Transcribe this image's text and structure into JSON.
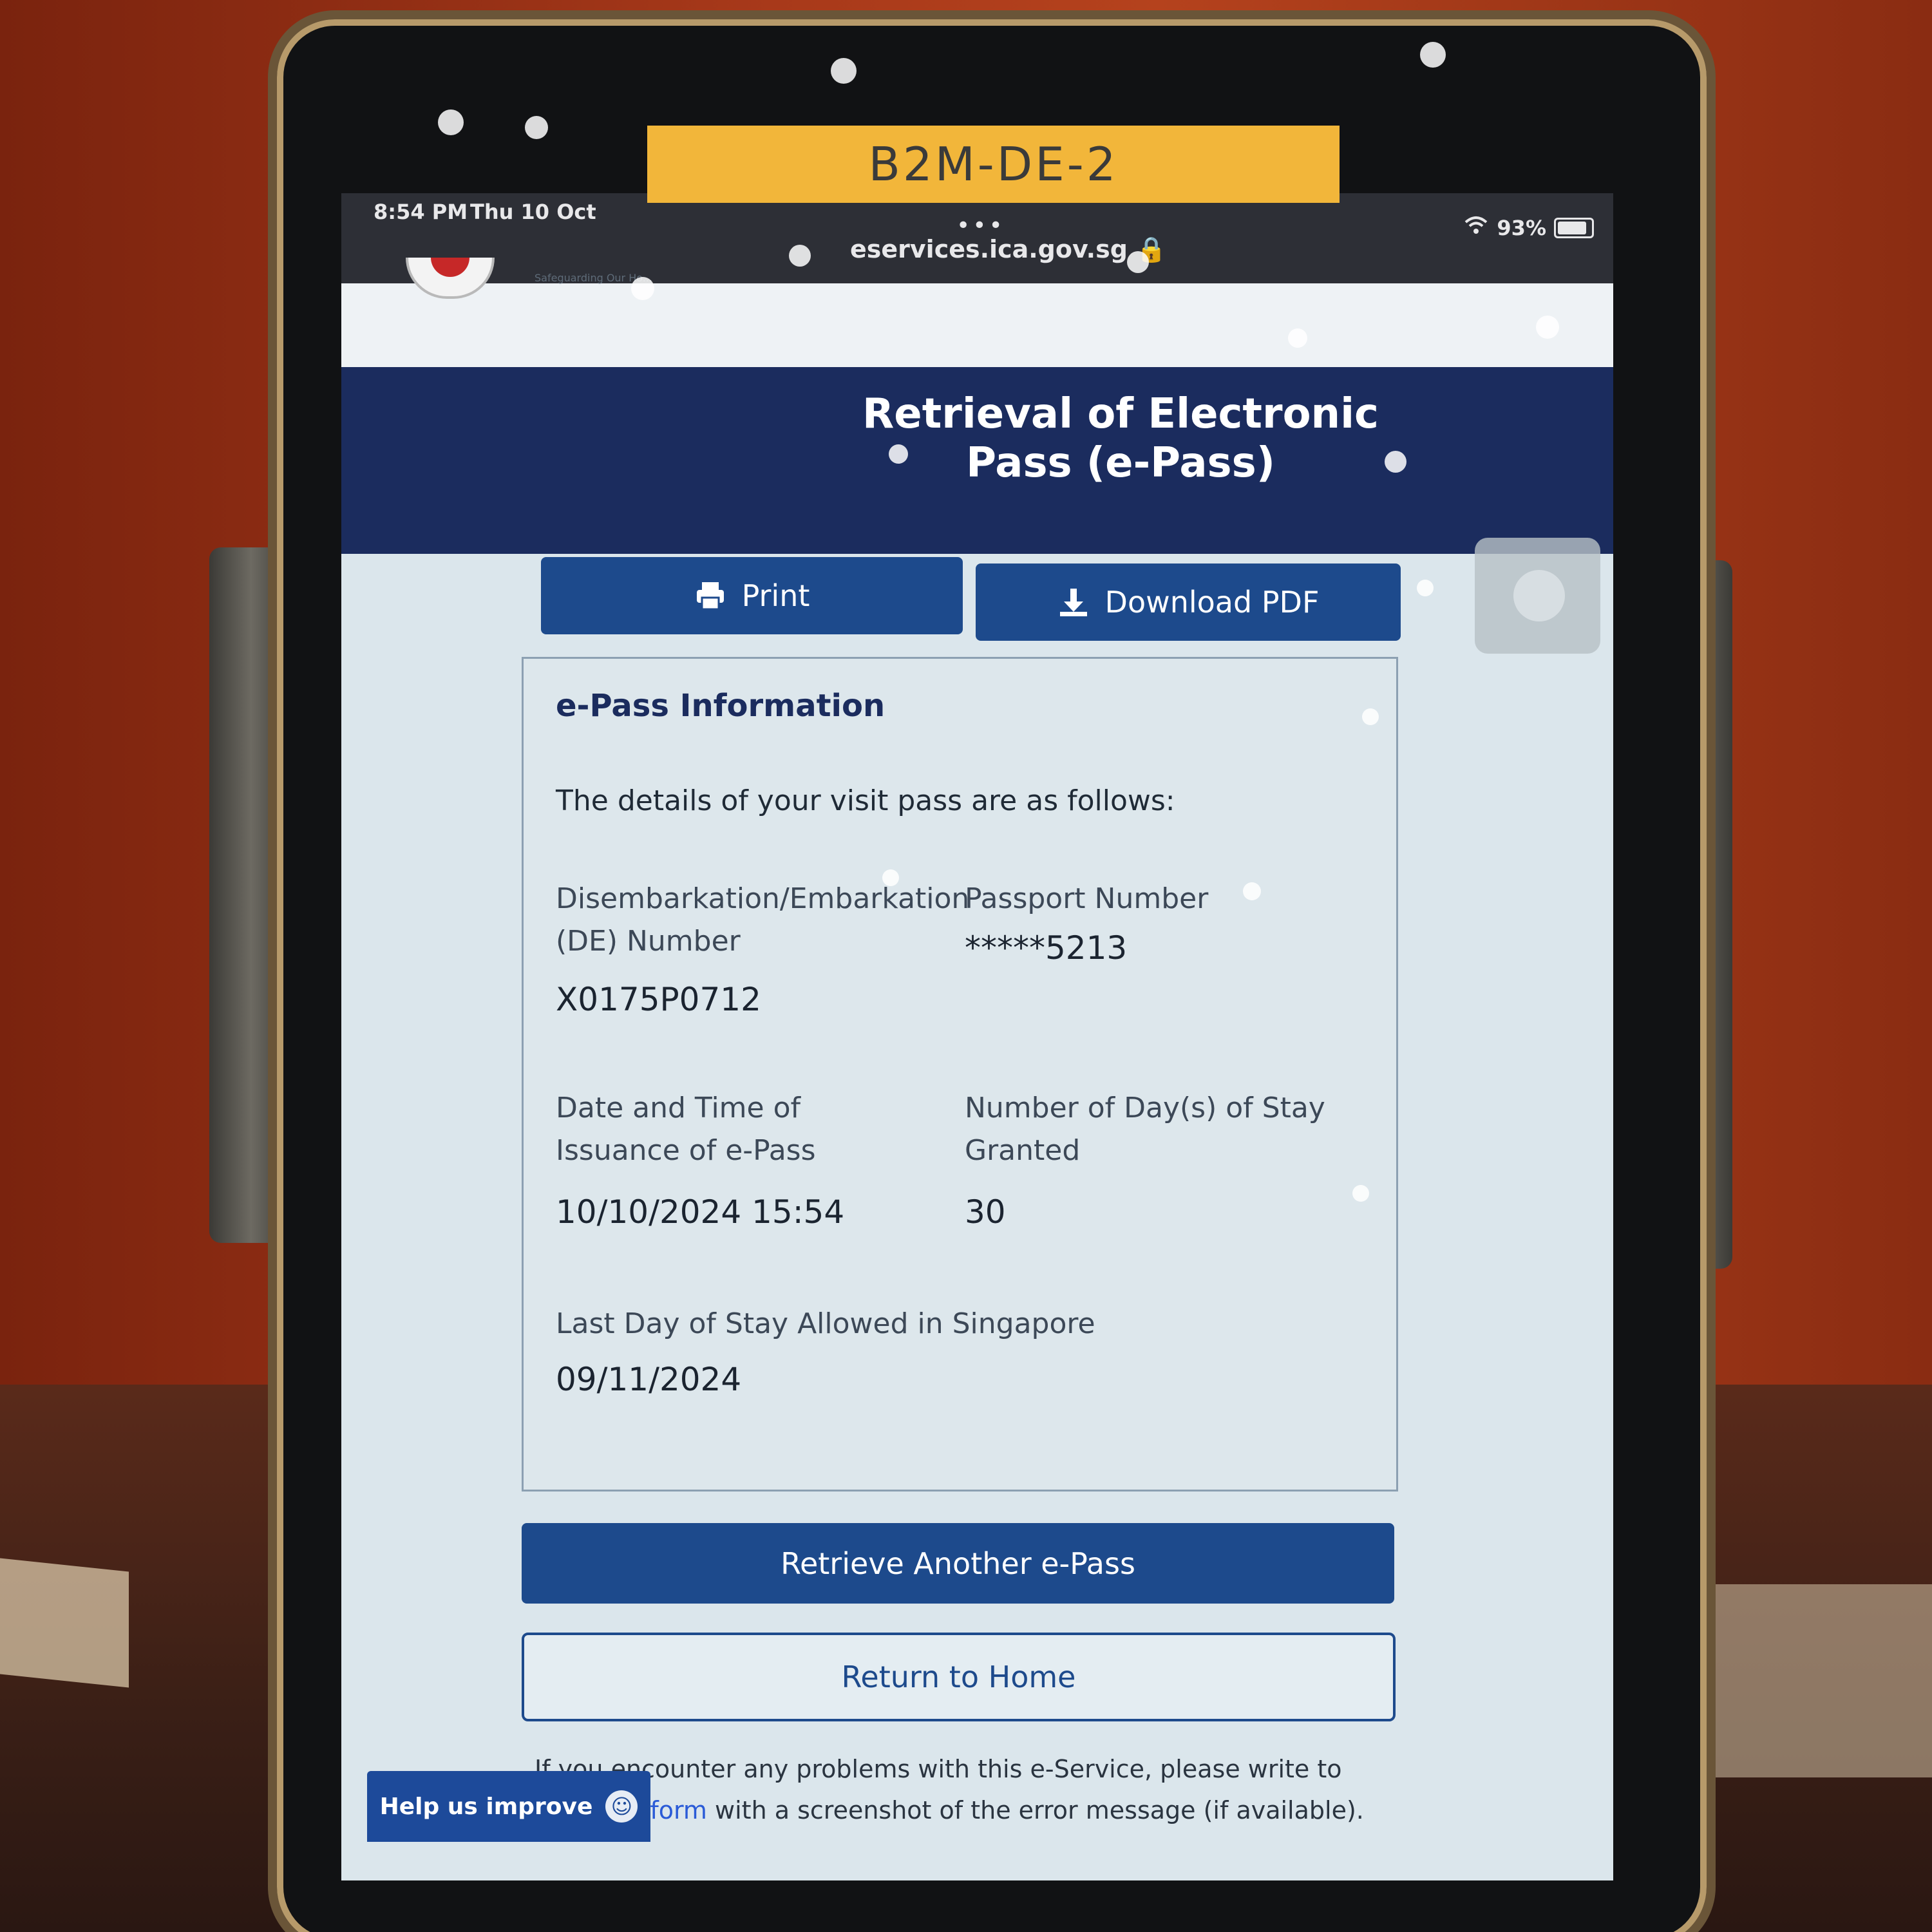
{
  "sticker": {
    "label": "B2M-DE-2"
  },
  "status_bar": {
    "time": "8:54 PM",
    "date": "Thu 10 Oct",
    "battery": "93%",
    "url_dots": "•••",
    "url": "eservices.ica.gov.sg 🔒"
  },
  "header": {
    "logo_tagline": "Safeguarding Our Ho..."
  },
  "banner": {
    "title": "Retrieval of Electronic Pass (e-Pass)"
  },
  "toolbar": {
    "print_label": "Print",
    "download_label": "Download PDF"
  },
  "card": {
    "title": "e-Pass Information",
    "intro": "The details of your visit pass are as follows:",
    "fields": [
      {
        "label": "Disembarkation/Embarkation (DE) Number",
        "value": "X0175P0712"
      },
      {
        "label": "Passport Number",
        "value": "*****5213"
      },
      {
        "label": "Date and Time of Issuance of e-Pass",
        "value": "10/10/2024 15:54"
      },
      {
        "label": "Number of Day(s) of Stay Granted",
        "value": "30"
      },
      {
        "label": "Last Day of Stay Allowed in Singapore",
        "value": "09/11/2024"
      }
    ]
  },
  "actions": {
    "retrieve_label": "Retrieve Another e-Pass",
    "home_label": "Return to Home"
  },
  "footer": {
    "text_before": "If you encounter any problems with this e-Service, please write to us via ",
    "link_text": "ck form",
    "text_after": " with a screenshot of the error message (if available)."
  },
  "help": {
    "label": "Help us improve",
    "icon": "smiley-icon"
  }
}
